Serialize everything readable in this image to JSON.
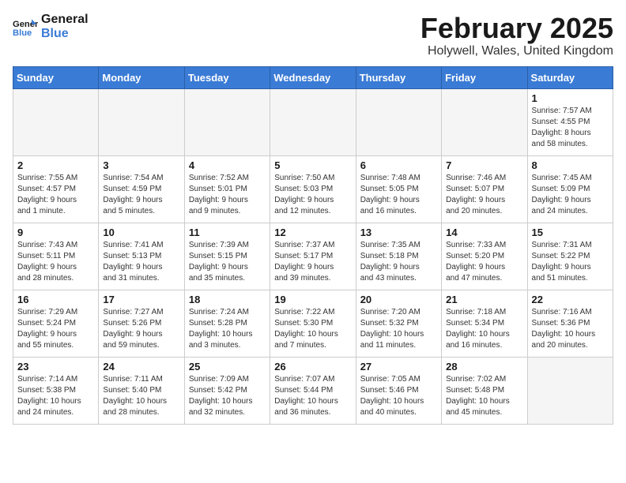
{
  "header": {
    "logo_line1": "General",
    "logo_line2": "Blue",
    "month": "February 2025",
    "location": "Holywell, Wales, United Kingdom"
  },
  "weekdays": [
    "Sunday",
    "Monday",
    "Tuesday",
    "Wednesday",
    "Thursday",
    "Friday",
    "Saturday"
  ],
  "weeks": [
    [
      {
        "day": "",
        "info": ""
      },
      {
        "day": "",
        "info": ""
      },
      {
        "day": "",
        "info": ""
      },
      {
        "day": "",
        "info": ""
      },
      {
        "day": "",
        "info": ""
      },
      {
        "day": "",
        "info": ""
      },
      {
        "day": "1",
        "info": "Sunrise: 7:57 AM\nSunset: 4:55 PM\nDaylight: 8 hours\nand 58 minutes."
      }
    ],
    [
      {
        "day": "2",
        "info": "Sunrise: 7:55 AM\nSunset: 4:57 PM\nDaylight: 9 hours\nand 1 minute."
      },
      {
        "day": "3",
        "info": "Sunrise: 7:54 AM\nSunset: 4:59 PM\nDaylight: 9 hours\nand 5 minutes."
      },
      {
        "day": "4",
        "info": "Sunrise: 7:52 AM\nSunset: 5:01 PM\nDaylight: 9 hours\nand 9 minutes."
      },
      {
        "day": "5",
        "info": "Sunrise: 7:50 AM\nSunset: 5:03 PM\nDaylight: 9 hours\nand 12 minutes."
      },
      {
        "day": "6",
        "info": "Sunrise: 7:48 AM\nSunset: 5:05 PM\nDaylight: 9 hours\nand 16 minutes."
      },
      {
        "day": "7",
        "info": "Sunrise: 7:46 AM\nSunset: 5:07 PM\nDaylight: 9 hours\nand 20 minutes."
      },
      {
        "day": "8",
        "info": "Sunrise: 7:45 AM\nSunset: 5:09 PM\nDaylight: 9 hours\nand 24 minutes."
      }
    ],
    [
      {
        "day": "9",
        "info": "Sunrise: 7:43 AM\nSunset: 5:11 PM\nDaylight: 9 hours\nand 28 minutes."
      },
      {
        "day": "10",
        "info": "Sunrise: 7:41 AM\nSunset: 5:13 PM\nDaylight: 9 hours\nand 31 minutes."
      },
      {
        "day": "11",
        "info": "Sunrise: 7:39 AM\nSunset: 5:15 PM\nDaylight: 9 hours\nand 35 minutes."
      },
      {
        "day": "12",
        "info": "Sunrise: 7:37 AM\nSunset: 5:17 PM\nDaylight: 9 hours\nand 39 minutes."
      },
      {
        "day": "13",
        "info": "Sunrise: 7:35 AM\nSunset: 5:18 PM\nDaylight: 9 hours\nand 43 minutes."
      },
      {
        "day": "14",
        "info": "Sunrise: 7:33 AM\nSunset: 5:20 PM\nDaylight: 9 hours\nand 47 minutes."
      },
      {
        "day": "15",
        "info": "Sunrise: 7:31 AM\nSunset: 5:22 PM\nDaylight: 9 hours\nand 51 minutes."
      }
    ],
    [
      {
        "day": "16",
        "info": "Sunrise: 7:29 AM\nSunset: 5:24 PM\nDaylight: 9 hours\nand 55 minutes."
      },
      {
        "day": "17",
        "info": "Sunrise: 7:27 AM\nSunset: 5:26 PM\nDaylight: 9 hours\nand 59 minutes."
      },
      {
        "day": "18",
        "info": "Sunrise: 7:24 AM\nSunset: 5:28 PM\nDaylight: 10 hours\nand 3 minutes."
      },
      {
        "day": "19",
        "info": "Sunrise: 7:22 AM\nSunset: 5:30 PM\nDaylight: 10 hours\nand 7 minutes."
      },
      {
        "day": "20",
        "info": "Sunrise: 7:20 AM\nSunset: 5:32 PM\nDaylight: 10 hours\nand 11 minutes."
      },
      {
        "day": "21",
        "info": "Sunrise: 7:18 AM\nSunset: 5:34 PM\nDaylight: 10 hours\nand 16 minutes."
      },
      {
        "day": "22",
        "info": "Sunrise: 7:16 AM\nSunset: 5:36 PM\nDaylight: 10 hours\nand 20 minutes."
      }
    ],
    [
      {
        "day": "23",
        "info": "Sunrise: 7:14 AM\nSunset: 5:38 PM\nDaylight: 10 hours\nand 24 minutes."
      },
      {
        "day": "24",
        "info": "Sunrise: 7:11 AM\nSunset: 5:40 PM\nDaylight: 10 hours\nand 28 minutes."
      },
      {
        "day": "25",
        "info": "Sunrise: 7:09 AM\nSunset: 5:42 PM\nDaylight: 10 hours\nand 32 minutes."
      },
      {
        "day": "26",
        "info": "Sunrise: 7:07 AM\nSunset: 5:44 PM\nDaylight: 10 hours\nand 36 minutes."
      },
      {
        "day": "27",
        "info": "Sunrise: 7:05 AM\nSunset: 5:46 PM\nDaylight: 10 hours\nand 40 minutes."
      },
      {
        "day": "28",
        "info": "Sunrise: 7:02 AM\nSunset: 5:48 PM\nDaylight: 10 hours\nand 45 minutes."
      },
      {
        "day": "",
        "info": ""
      }
    ]
  ]
}
